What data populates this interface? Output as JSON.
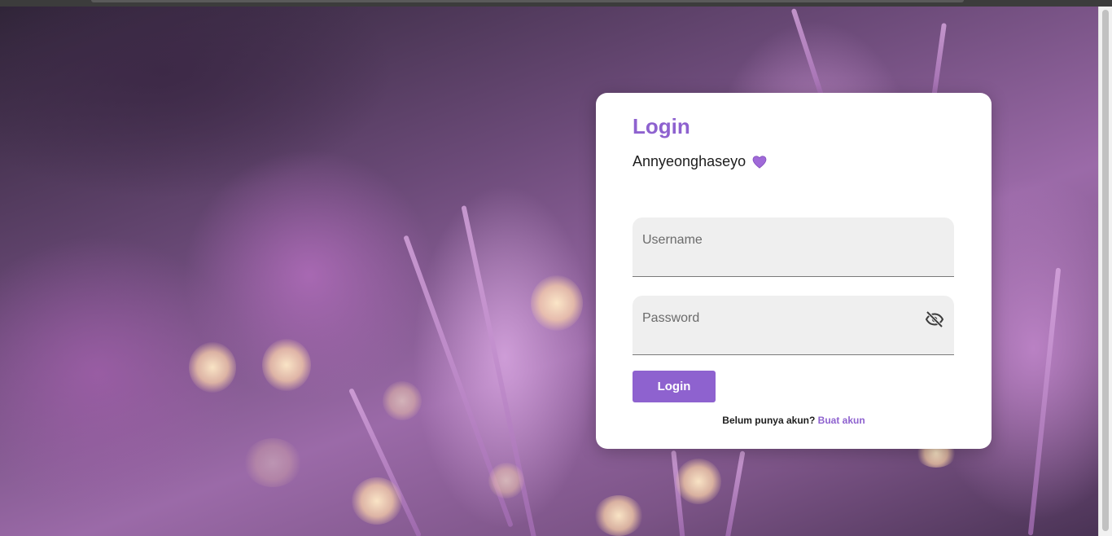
{
  "login_card": {
    "title": "Login",
    "greeting": "Annyeonghaseyo",
    "greeting_icon": "purple-heart-icon",
    "username_placeholder": "Username",
    "password_placeholder": "Password",
    "password_toggle_icon": "eye-off-icon",
    "submit_label": "Login",
    "signup_prompt": "Belum punya akun?",
    "signup_link": "Buat akun"
  },
  "colors": {
    "accent": "#8e62cf",
    "field_bg": "#efefef",
    "card_bg": "#ffffff"
  }
}
